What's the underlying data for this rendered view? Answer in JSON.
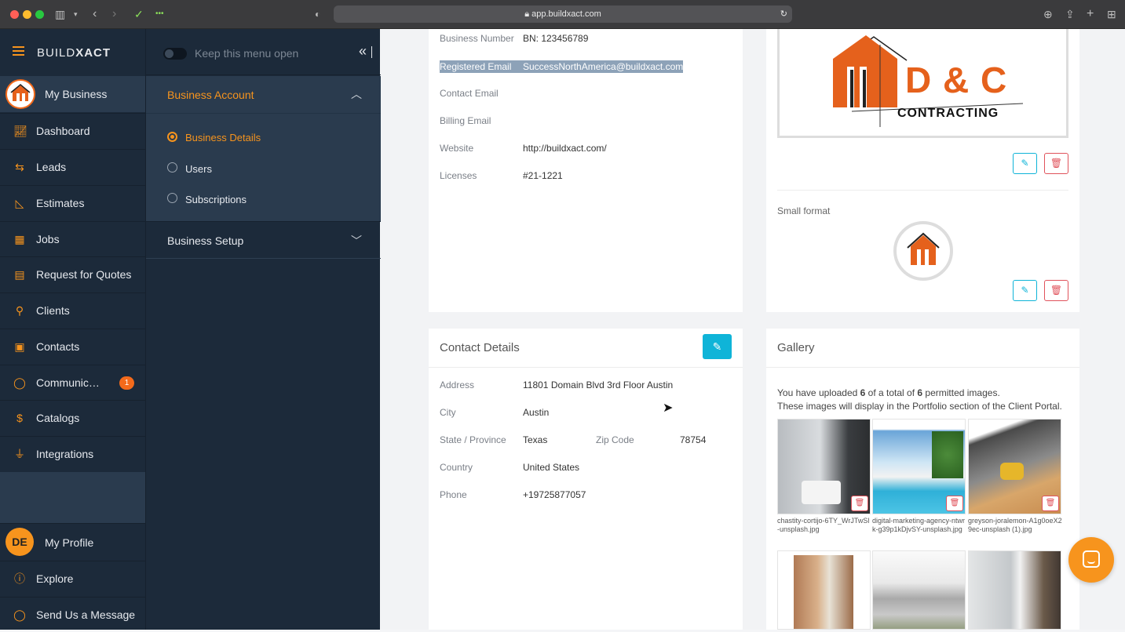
{
  "browser": {
    "url": "app.buildxact.com"
  },
  "brand": {
    "prefix": "BUILD",
    "suffix": "XACT"
  },
  "nav": {
    "business": "My Business",
    "items": [
      {
        "label": "Dashboard",
        "icon": "chart-icon"
      },
      {
        "label": "Leads",
        "icon": "arrows-icon"
      },
      {
        "label": "Estimates",
        "icon": "ruler-icon"
      },
      {
        "label": "Jobs",
        "icon": "calendar-icon"
      },
      {
        "label": "Request for Quotes",
        "icon": "document-icon"
      },
      {
        "label": "Clients",
        "icon": "person-icon"
      },
      {
        "label": "Contacts",
        "icon": "contact-card-icon"
      },
      {
        "label": "Communic…",
        "icon": "chat-icon",
        "badge": "1"
      },
      {
        "label": "Catalogs",
        "icon": "dollar-icon"
      },
      {
        "label": "Integrations",
        "icon": "plug-icon"
      }
    ],
    "profile_initials": "DE",
    "profile": "My Profile",
    "explore": "Explore",
    "message": "Send Us a Message"
  },
  "subnav": {
    "keep_open": "Keep this menu open",
    "business_account": "Business Account",
    "items": [
      {
        "label": "Business Details",
        "selected": true
      },
      {
        "label": "Users",
        "selected": false
      },
      {
        "label": "Subscriptions",
        "selected": false
      }
    ],
    "business_setup": "Business Setup"
  },
  "business": {
    "rows": [
      {
        "label": "Business Number",
        "value": "BN: 123456789"
      },
      {
        "label": "Registered Email",
        "value": "SuccessNorthAmerica@buildxact.com"
      },
      {
        "label": "Contact Email",
        "value": ""
      },
      {
        "label": "Billing Email",
        "value": ""
      },
      {
        "label": "Website",
        "value": "http://buildxact.com/"
      },
      {
        "label": "Licenses",
        "value": "#21-1221"
      }
    ]
  },
  "logo": {
    "name": "D & C",
    "sub": "CONTRACTING",
    "small_format": "Small format"
  },
  "contact": {
    "title": "Contact Details",
    "address_label": "Address",
    "address": "11801 Domain Blvd 3rd Floor Austin",
    "city_label": "City",
    "city": "Austin",
    "state_label": "State / Province",
    "state": "Texas",
    "zip_label": "Zip Code",
    "zip": "78754",
    "country_label": "Country",
    "country": "United States",
    "phone_label": "Phone",
    "phone": "+19725877057"
  },
  "gallery": {
    "title": "Gallery",
    "line1_a": "You have uploaded ",
    "uploaded": "6",
    "line1_b": " of a total of ",
    "total": "6",
    "line1_c": " permitted images.",
    "line2": "These images will display in the Portfolio section of the Client Portal.",
    "images": [
      {
        "caption": "chastity-cortijo-6TY_WrJTwSl-unsplash.jpg"
      },
      {
        "caption": "digital-marketing-agency-ntwrk-g39p1kDjvSY-unsplash.jpg"
      },
      {
        "caption": "greyson-joralemon-A1g0oeX29ec-unsplash (1).jpg"
      }
    ]
  },
  "colors": {
    "nav_bg": "#1c2a3a",
    "accent": "#f7941d",
    "edit": "#0fb4d8",
    "delete": "#e0525b"
  }
}
